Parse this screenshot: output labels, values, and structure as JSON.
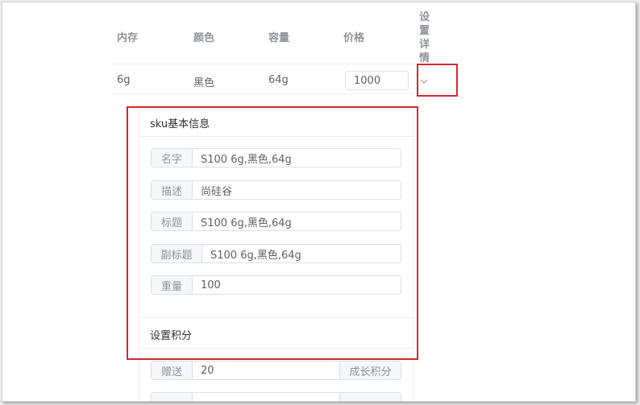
{
  "table": {
    "headers": {
      "memory": "内存",
      "color": "颜色",
      "capacity": "容量",
      "price": "价格",
      "details": "设置详情"
    },
    "row": {
      "memory": "6g",
      "color": "黑色",
      "capacity": "64g",
      "price": "1000"
    }
  },
  "sku": {
    "title": "sku基本信息",
    "fields": [
      {
        "label": "名字",
        "value": "S100 6g,黑色,64g"
      },
      {
        "label": "描述",
        "value": "尚硅谷"
      },
      {
        "label": "标题",
        "value": "S100 6g,黑色,64g"
      },
      {
        "label": "副标题",
        "value": "S100 6g,黑色,64g"
      },
      {
        "label": "重量",
        "value": "100"
      }
    ],
    "points": {
      "title": "设置积分",
      "gift_label": "赠送",
      "gift_value": "20",
      "growth_label": "成长积分"
    }
  },
  "colors": {
    "highlight": "#d9262c",
    "border": "#dcdfe6",
    "header_text": "#909399"
  },
  "icons": {
    "expand": "chevron-down-icon"
  }
}
